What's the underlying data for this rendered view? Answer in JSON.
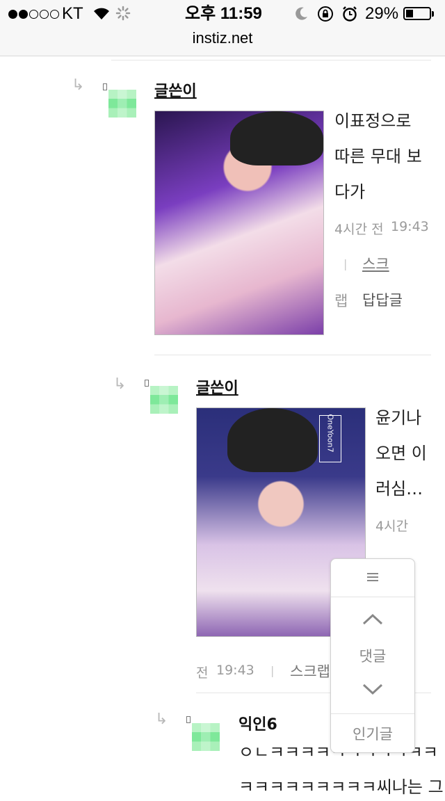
{
  "status_bar": {
    "carrier": "KT",
    "time": "오후 11:59",
    "battery": "29%",
    "url": "instiz.net"
  },
  "comments": [
    {
      "author": "글쓴이",
      "text_lines": [
        "이표정으로",
        "따른 무대 보",
        "다가"
      ],
      "time_ago": "4시간 전",
      "time": "19:43",
      "scrap_label_part1": "스크",
      "scrap_label_part2": "랩",
      "reply_label": "답답글",
      "separator": "|"
    },
    {
      "author": "글쓴이",
      "text_lines": [
        "윤기나",
        "오면 이",
        "러심…"
      ],
      "time_ago_part1": "4시간",
      "time_ago_part2": "전",
      "time": "19:43",
      "scrap_label": "스크랩",
      "separator": "|",
      "image_watermark": "OneYoon7"
    },
    {
      "author": "익인6",
      "text_lines": [
        "ㅇㄴㅋㅋㅋㅋㅋㅋㅋㅋㅋㅋㅋ",
        "ㅋㅋㅋㅋㅋㅋㅋㅋㅋ씨나는 그"
      ]
    }
  ],
  "float_nav": {
    "menu_icon": "hamburger-icon",
    "up_icon": "chevron-up-icon",
    "comment_label": "댓글",
    "down_icon": "chevron-down-icon",
    "popular_label": "인기글"
  }
}
